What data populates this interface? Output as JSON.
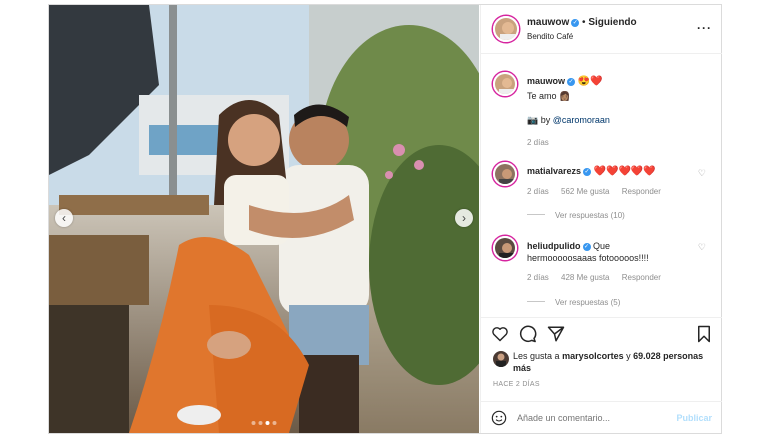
{
  "header": {
    "username": "mauwow",
    "separator": "•",
    "follow_status": "Siguiendo",
    "location": "Bendito Café",
    "more_icon": "more-horizontal-icon"
  },
  "caption": {
    "username": "mauwow",
    "emojis": "😍❤️",
    "text": "Te amo 👩🏽",
    "credit_prefix": "📷 by",
    "credit_handle": "@caromoraan",
    "time": "2 días"
  },
  "comments": [
    {
      "username": "matialvarezs",
      "text": "❤️❤️❤️❤️❤️",
      "time": "2 días",
      "likes": "562 Me gusta",
      "reply_label": "Responder",
      "view_replies": "Ver respuestas (10)"
    },
    {
      "username": "heliudpulido",
      "text": "Que hermooooosaaas fotooooos!!!!",
      "time": "2 días",
      "likes": "428 Me gusta",
      "reply_label": "Responder",
      "view_replies": "Ver respuestas (5)"
    }
  ],
  "likes_summary": {
    "prefix": "Les gusta a",
    "user": "marysolcortes",
    "connector": "y",
    "count": "69.028 personas más"
  },
  "post_age": "HACE 2 DÍAS",
  "add_comment": {
    "placeholder": "Añade un comentario...",
    "publish_label": "Publicar"
  },
  "carousel": {
    "total": 4,
    "active": 2
  },
  "colors": {
    "accent": "#3897f0",
    "heart": "#ed4956",
    "muted": "#8e8e8e"
  }
}
